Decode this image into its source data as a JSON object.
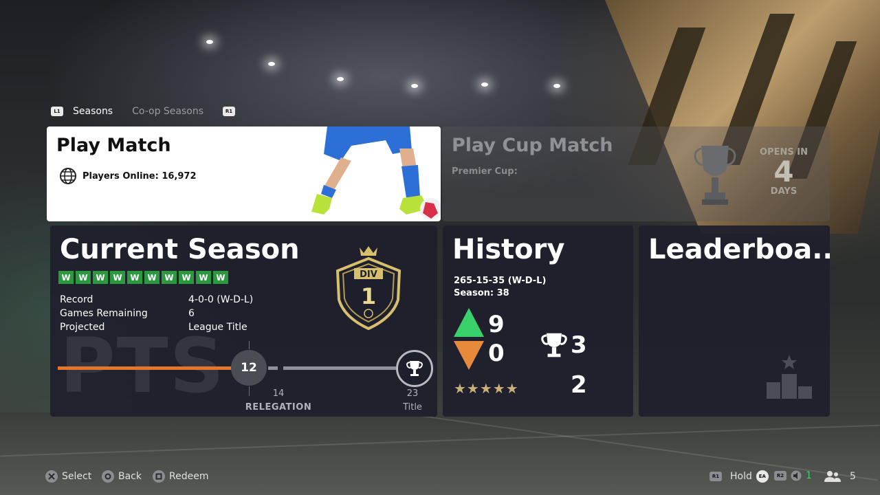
{
  "tabs": {
    "left_button": "L1",
    "right_button": "R1",
    "items": [
      {
        "label": "Seasons",
        "active": true
      },
      {
        "label": "Co-op Seasons",
        "active": false
      }
    ]
  },
  "play_match": {
    "title": "Play Match",
    "players_online": "Players Online: 16,972"
  },
  "cup_match": {
    "title": "Play Cup Match",
    "subtitle": "Premier Cup:",
    "opens_in_label": "OPENS IN",
    "opens_in_value": "4",
    "opens_in_unit": "DAYS"
  },
  "current_season": {
    "title": "Current Season",
    "results": [
      "W",
      "W",
      "W",
      "W",
      "W",
      "W",
      "W",
      "W",
      "W",
      "W"
    ],
    "stats": [
      {
        "label": "Record",
        "value": "4-0-0 (W-D-L)"
      },
      {
        "label": "Games Remaining",
        "value": "6"
      },
      {
        "label": "Projected",
        "value": "League Title"
      }
    ],
    "badge_top": "DIV",
    "division": "1",
    "watermark": "PTS",
    "points": {
      "current": "12",
      "current_value": 12,
      "relegation_value": "14",
      "relegation_label": "RELEGATION",
      "title_value": "23",
      "title_label": "Title"
    }
  },
  "history": {
    "title": "History",
    "record": "265-15-35 (W-D-L)",
    "season": "Season: 38",
    "promotions": "9",
    "relegations": "0",
    "titles": "3",
    "second_stat": "2",
    "star_rating": 5
  },
  "leaderboard": {
    "title": "Leaderboa..."
  },
  "footer": {
    "select": "Select",
    "back": "Back",
    "redeem": "Redeem",
    "hold": "Hold",
    "r1": "R1",
    "r2": "R2",
    "ea": "EA",
    "notifications": "1",
    "friends": "5"
  },
  "colors": {
    "win": "#2b9a3f",
    "progress": "#e2762e",
    "promotion": "#39d26a",
    "relegation": "#e88a3b",
    "gold": "#c9b27a"
  }
}
